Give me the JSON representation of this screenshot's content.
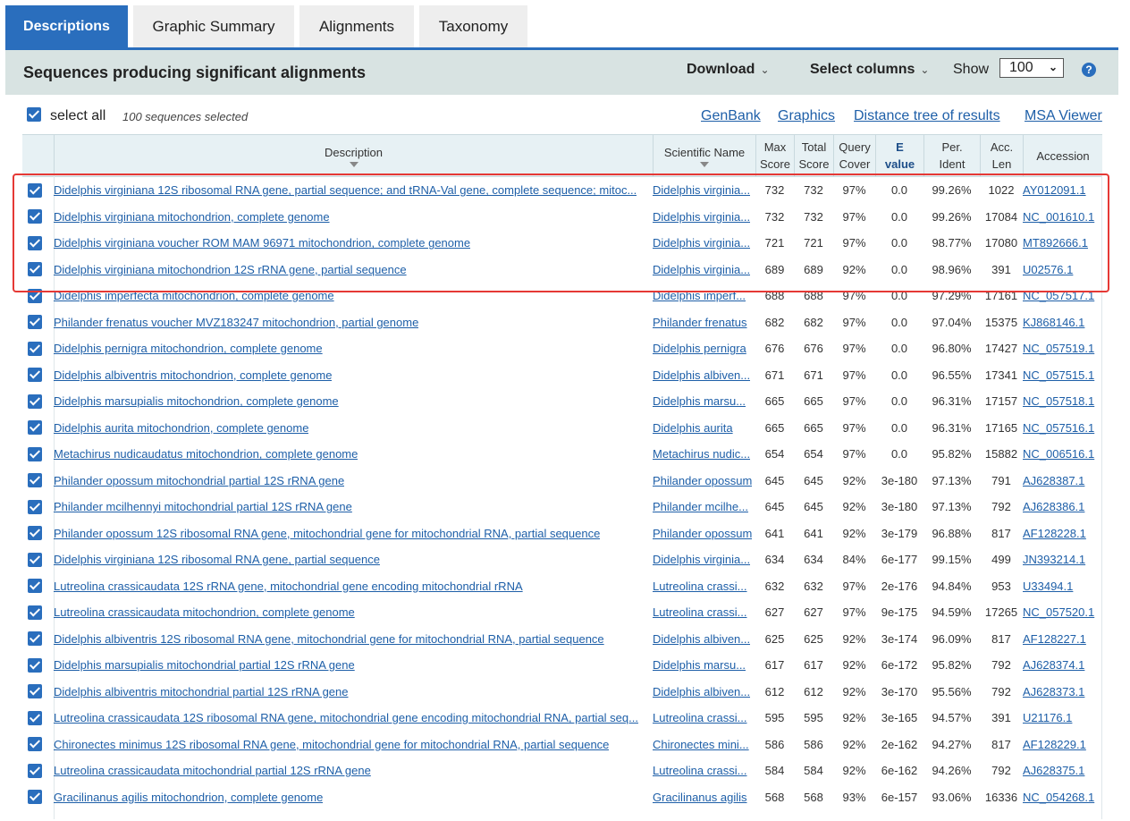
{
  "tabs": [
    {
      "label": "Descriptions",
      "active": true
    },
    {
      "label": "Graphic Summary",
      "active": false
    },
    {
      "label": "Alignments",
      "active": false
    },
    {
      "label": "Taxonomy",
      "active": false
    }
  ],
  "header": {
    "title": "Sequences producing significant alignments",
    "download": "Download",
    "select_columns": "Select columns",
    "show": "Show",
    "show_value": "100",
    "help": "?"
  },
  "toolbar": {
    "select_all": "select all",
    "selected_count": "100 sequences selected",
    "links": [
      "GenBank",
      "Graphics",
      "Distance tree of results",
      "MSA Viewer"
    ]
  },
  "columns": {
    "description": "Description",
    "scientific_name": "Scientific Name",
    "max_score": [
      "Max",
      "Score"
    ],
    "total_score": [
      "Total",
      "Score"
    ],
    "query_cover": [
      "Query",
      "Cover"
    ],
    "e_value": [
      "E",
      "value"
    ],
    "per_ident": [
      "Per.",
      "Ident"
    ],
    "acc_len": [
      "Acc.",
      "Len"
    ],
    "accession": "Accession"
  },
  "colors": {
    "accent": "#2a6ebd",
    "header_bg": "#d8e3e2",
    "highlight_box": "#e53935"
  },
  "rows": [
    {
      "desc": "Didelphis virginiana 12S ribosomal RNA gene, partial sequence; and tRNA-Val gene, complete sequence; mitoc...",
      "sci": "Didelphis virginia...",
      "max": "732",
      "total": "732",
      "cover": "97%",
      "e": "0.0",
      "ident": "99.26%",
      "len": "1022",
      "acc": "AY012091.1"
    },
    {
      "desc": "Didelphis virginiana mitochondrion, complete genome",
      "sci": "Didelphis virginia...",
      "max": "732",
      "total": "732",
      "cover": "97%",
      "e": "0.0",
      "ident": "99.26%",
      "len": "17084",
      "acc": "NC_001610.1"
    },
    {
      "desc": "Didelphis virginiana voucher ROM MAM 96971 mitochondrion, complete genome",
      "sci": "Didelphis virginia...",
      "max": "721",
      "total": "721",
      "cover": "97%",
      "e": "0.0",
      "ident": "98.77%",
      "len": "17080",
      "acc": "MT892666.1"
    },
    {
      "desc": "Didelphis virginiana mitochondrion 12S rRNA gene, partial sequence",
      "sci": "Didelphis virginia...",
      "max": "689",
      "total": "689",
      "cover": "92%",
      "e": "0.0",
      "ident": "98.96%",
      "len": "391",
      "acc": "U02576.1"
    },
    {
      "desc": "Didelphis imperfecta mitochondrion, complete genome",
      "sci": "Didelphis imperf...",
      "max": "688",
      "total": "688",
      "cover": "97%",
      "e": "0.0",
      "ident": "97.29%",
      "len": "17161",
      "acc": "NC_057517.1"
    },
    {
      "desc": "Philander frenatus voucher MVZ183247 mitochondrion, partial genome",
      "sci": "Philander frenatus",
      "max": "682",
      "total": "682",
      "cover": "97%",
      "e": "0.0",
      "ident": "97.04%",
      "len": "15375",
      "acc": "KJ868146.1"
    },
    {
      "desc": "Didelphis pernigra mitochondrion, complete genome",
      "sci": "Didelphis pernigra",
      "max": "676",
      "total": "676",
      "cover": "97%",
      "e": "0.0",
      "ident": "96.80%",
      "len": "17427",
      "acc": "NC_057519.1"
    },
    {
      "desc": "Didelphis albiventris mitochondrion, complete genome",
      "sci": "Didelphis albiven...",
      "max": "671",
      "total": "671",
      "cover": "97%",
      "e": "0.0",
      "ident": "96.55%",
      "len": "17341",
      "acc": "NC_057515.1"
    },
    {
      "desc": "Didelphis marsupialis mitochondrion, complete genome",
      "sci": "Didelphis marsu...",
      "max": "665",
      "total": "665",
      "cover": "97%",
      "e": "0.0",
      "ident": "96.31%",
      "len": "17157",
      "acc": "NC_057518.1"
    },
    {
      "desc": "Didelphis aurita mitochondrion, complete genome",
      "sci": "Didelphis aurita",
      "max": "665",
      "total": "665",
      "cover": "97%",
      "e": "0.0",
      "ident": "96.31%",
      "len": "17165",
      "acc": "NC_057516.1"
    },
    {
      "desc": "Metachirus nudicaudatus mitochondrion, complete genome",
      "sci": "Metachirus nudic...",
      "max": "654",
      "total": "654",
      "cover": "97%",
      "e": "0.0",
      "ident": "95.82%",
      "len": "15882",
      "acc": "NC_006516.1"
    },
    {
      "desc": "Philander opossum mitochondrial partial 12S rRNA gene",
      "sci": "Philander opossum",
      "max": "645",
      "total": "645",
      "cover": "92%",
      "e": "3e-180",
      "ident": "97.13%",
      "len": "791",
      "acc": "AJ628387.1"
    },
    {
      "desc": "Philander mcilhennyi mitochondrial partial 12S rRNA gene",
      "sci": "Philander mcilhe...",
      "max": "645",
      "total": "645",
      "cover": "92%",
      "e": "3e-180",
      "ident": "97.13%",
      "len": "792",
      "acc": "AJ628386.1"
    },
    {
      "desc": "Philander opossum 12S ribosomal RNA gene, mitochondrial gene for mitochondrial RNA, partial sequence",
      "sci": "Philander opossum",
      "max": "641",
      "total": "641",
      "cover": "92%",
      "e": "3e-179",
      "ident": "96.88%",
      "len": "817",
      "acc": "AF128228.1"
    },
    {
      "desc": "Didelphis virginiana 12S ribosomal RNA gene, partial sequence",
      "sci": "Didelphis virginia...",
      "max": "634",
      "total": "634",
      "cover": "84%",
      "e": "6e-177",
      "ident": "99.15%",
      "len": "499",
      "acc": "JN393214.1"
    },
    {
      "desc": "Lutreolina crassicaudata 12S rRNA gene, mitochondrial gene encoding mitochondrial rRNA",
      "sci": "Lutreolina crassi...",
      "max": "632",
      "total": "632",
      "cover": "97%",
      "e": "2e-176",
      "ident": "94.84%",
      "len": "953",
      "acc": "U33494.1"
    },
    {
      "desc": "Lutreolina crassicaudata mitochondrion, complete genome",
      "sci": "Lutreolina crassi...",
      "max": "627",
      "total": "627",
      "cover": "97%",
      "e": "9e-175",
      "ident": "94.59%",
      "len": "17265",
      "acc": "NC_057520.1"
    },
    {
      "desc": "Didelphis albiventris 12S ribosomal RNA gene, mitochondrial gene for mitochondrial RNA, partial sequence",
      "sci": "Didelphis albiven...",
      "max": "625",
      "total": "625",
      "cover": "92%",
      "e": "3e-174",
      "ident": "96.09%",
      "len": "817",
      "acc": "AF128227.1"
    },
    {
      "desc": "Didelphis marsupialis mitochondrial partial 12S rRNA gene",
      "sci": "Didelphis marsu...",
      "max": "617",
      "total": "617",
      "cover": "92%",
      "e": "6e-172",
      "ident": "95.82%",
      "len": "792",
      "acc": "AJ628374.1"
    },
    {
      "desc": "Didelphis albiventris mitochondrial partial 12S rRNA gene",
      "sci": "Didelphis albiven...",
      "max": "612",
      "total": "612",
      "cover": "92%",
      "e": "3e-170",
      "ident": "95.56%",
      "len": "792",
      "acc": "AJ628373.1"
    },
    {
      "desc": "Lutreolina crassicaudata 12S ribosomal RNA gene, mitochondrial gene encoding mitochondrial RNA, partial seq...",
      "sci": "Lutreolina crassi...",
      "max": "595",
      "total": "595",
      "cover": "92%",
      "e": "3e-165",
      "ident": "94.57%",
      "len": "391",
      "acc": "U21176.1"
    },
    {
      "desc": "Chironectes minimus 12S ribosomal RNA gene, mitochondrial gene for mitochondrial RNA, partial sequence",
      "sci": "Chironectes mini...",
      "max": "586",
      "total": "586",
      "cover": "92%",
      "e": "2e-162",
      "ident": "94.27%",
      "len": "817",
      "acc": "AF128229.1"
    },
    {
      "desc": "Lutreolina crassicaudata mitochondrial partial 12S rRNA gene",
      "sci": "Lutreolina crassi...",
      "max": "584",
      "total": "584",
      "cover": "92%",
      "e": "6e-162",
      "ident": "94.26%",
      "len": "792",
      "acc": "AJ628375.1"
    },
    {
      "desc": "Gracilinanus agilis mitochondrion, complete genome",
      "sci": "Gracilinanus agilis",
      "max": "568",
      "total": "568",
      "cover": "93%",
      "e": "6e-157",
      "ident": "93.06%",
      "len": "16336",
      "acc": "NC_054268.1"
    }
  ]
}
